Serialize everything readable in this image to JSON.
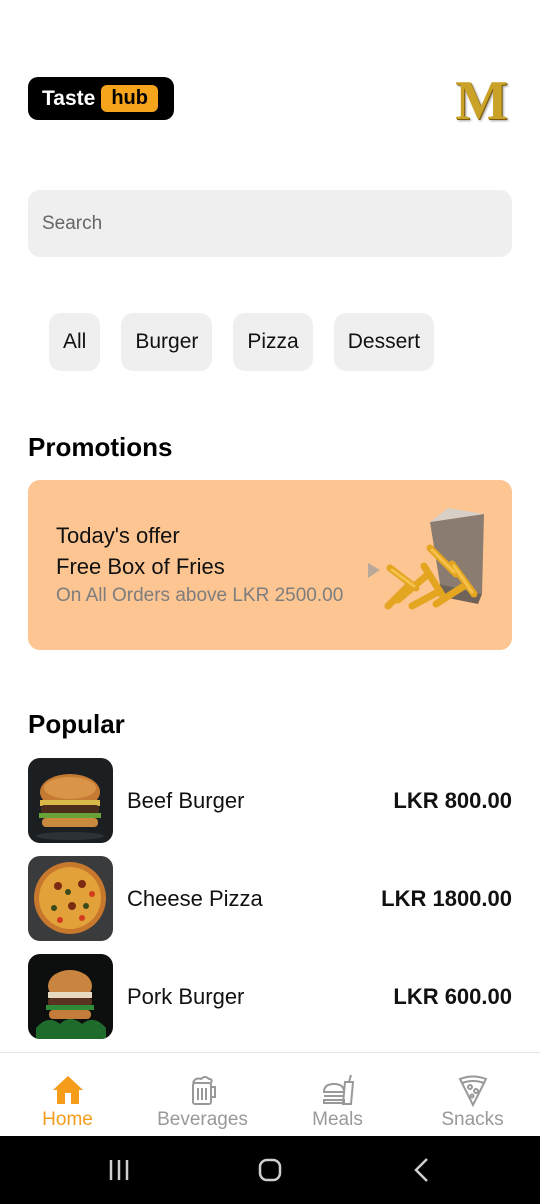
{
  "brand": {
    "word1": "Taste",
    "word2": "hub",
    "menu_letter": "M",
    "accent": "#f7a41d"
  },
  "search": {
    "placeholder": "Search"
  },
  "categories": [
    "All",
    "Burger",
    "Pizza",
    "Dessert"
  ],
  "promotions": {
    "title": "Promotions",
    "offer_label": "Today's offer",
    "offer_item": "Free Box of Fries",
    "offer_condition": "On All Orders above LKR 2500.00",
    "background": "#fdc592"
  },
  "popular": {
    "title": "Popular",
    "items": [
      {
        "name": "Beef Burger",
        "price": "LKR 800.00",
        "image": "beef-burger"
      },
      {
        "name": "Cheese Pizza",
        "price": "LKR 1800.00",
        "image": "cheese-pizza"
      },
      {
        "name": "Pork Burger",
        "price": "LKR 600.00",
        "image": "pork-burger"
      }
    ]
  },
  "nav": {
    "items": [
      {
        "label": "Home",
        "icon": "home-icon",
        "active": true
      },
      {
        "label": "Beverages",
        "icon": "beer-mug-icon",
        "active": false
      },
      {
        "label": "Meals",
        "icon": "burger-drink-icon",
        "active": false
      },
      {
        "label": "Snacks",
        "icon": "pizza-slice-icon",
        "active": false
      }
    ],
    "active_color": "#f59c1a",
    "inactive_color": "#999999"
  },
  "system_nav": {
    "buttons": [
      "recents-icon",
      "home-circle-icon",
      "back-chevron-icon"
    ]
  }
}
